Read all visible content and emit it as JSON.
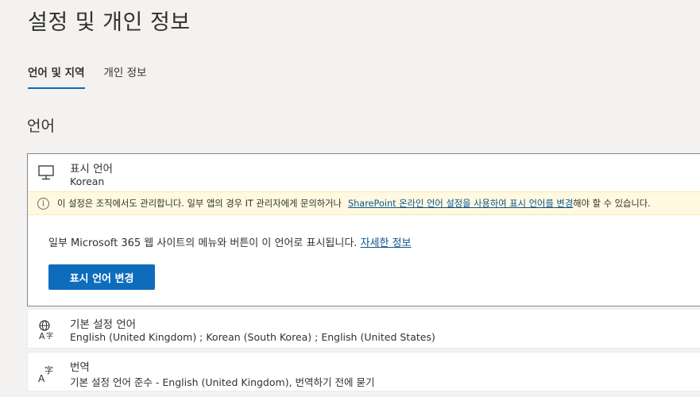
{
  "page": {
    "title": "설정 및 개인 정보"
  },
  "tabs": [
    {
      "label": "언어 및 지역",
      "active": true
    },
    {
      "label": "개인 정보",
      "active": false
    }
  ],
  "section": {
    "title": "언어"
  },
  "display_language": {
    "icon": "monitor-icon",
    "title": "표시 언어",
    "value": "Korean",
    "banner": {
      "icon": "info-icon",
      "icon_glyph": "i",
      "text_before": "이 설정은 조직에서도 관리합니다. 일부 앱의 경우 IT 관리자에게 문의하거나",
      "link": "SharePoint 온라인 언어 설정을 사용하여 표시 언어를 변경",
      "text_after": "해야 할 수 있습니다."
    },
    "description": "일부 Microsoft 365 웹 사이트의 메뉴와 버튼이 이 언어로 표시됩니다. ",
    "learn_more": "자세한 정보",
    "button": "표시 언어 변경"
  },
  "preferred_languages": {
    "icon": "language-icon",
    "title": "기본 설정 언어",
    "value": "English (United Kingdom) ; Korean (South Korea) ; English (United States)"
  },
  "translation": {
    "icon": "translate-icon",
    "title": "번역",
    "value": "기본 설정 언어 준수 - English (United Kingdom), 번역하기 전에 묻기"
  },
  "colors": {
    "accent": "#0f6cbd",
    "link": "#0f548c",
    "banner_bg": "#fff9e1",
    "page_bg": "#f3f2f1"
  }
}
